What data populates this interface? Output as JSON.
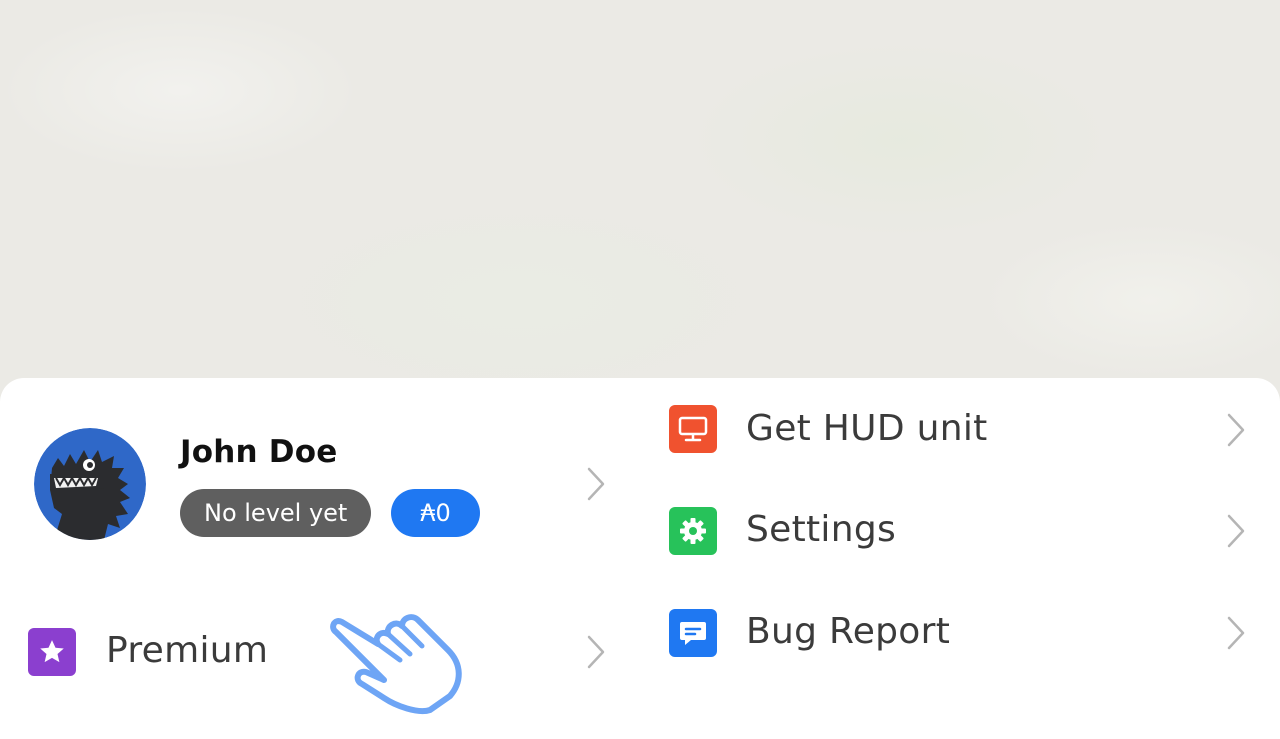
{
  "profile": {
    "name": "John Doe",
    "level": "No level yet",
    "coins": "₳0",
    "avatar_icon": "dinosaur-avatar-icon"
  },
  "menu_left": [
    {
      "label": "Premium",
      "icon": "star-icon",
      "color": "#8b3fcf"
    }
  ],
  "menu_right": [
    {
      "label": "Get HUD unit",
      "icon": "monitor-icon",
      "color": "#f0522f"
    },
    {
      "label": "Settings",
      "icon": "gear-icon",
      "color": "#27c25a"
    },
    {
      "label": "Bug Report",
      "icon": "chat-bubble-icon",
      "color": "#1f78f2"
    }
  ],
  "colors": {
    "accent": "#1f78f2",
    "level_pill": "#5f5f5f",
    "pointer_hand": "#6ea5f5"
  }
}
